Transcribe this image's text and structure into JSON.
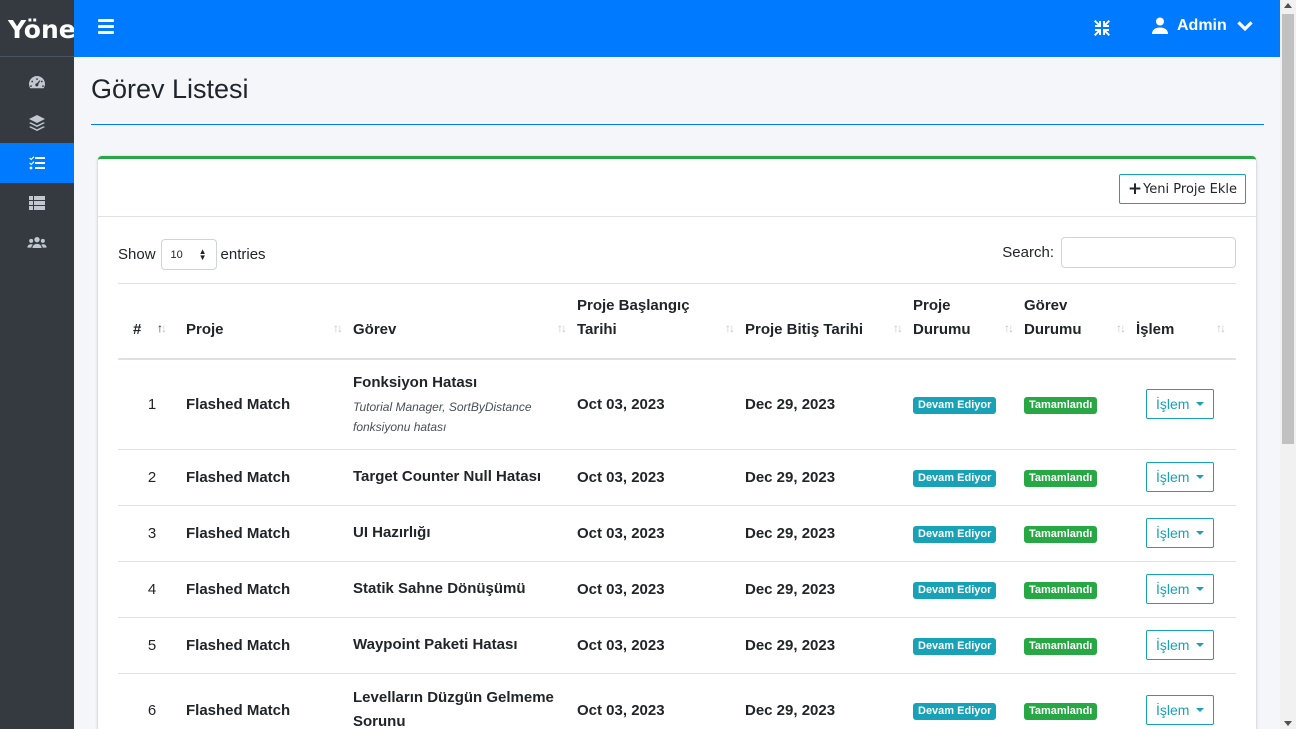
{
  "brand": "Yönetim",
  "nav": [
    {
      "icon": "dashboard-icon",
      "active": false
    },
    {
      "icon": "layers-icon",
      "active": false
    },
    {
      "icon": "task-list-icon",
      "active": true
    },
    {
      "icon": "table-icon",
      "active": false
    },
    {
      "icon": "users-icon",
      "active": false
    }
  ],
  "header": {
    "user": "Admin"
  },
  "page_title": "Görev Listesi",
  "card": {
    "new_button": "Yeni Proje Ekle"
  },
  "table_controls": {
    "show_label": "Show",
    "page_length": "10",
    "entries_label": "entries",
    "search_label": "Search:"
  },
  "columns": [
    "#",
    "Proje",
    "Görev",
    "Proje Başlangıç Tarihi",
    "Proje Bitiş Tarihi",
    "Proje Durumu",
    "Görev Durumu",
    "İşlem"
  ],
  "rows": [
    {
      "no": "1",
      "project": "Flashed Match",
      "task": "Fonksiyon Hatası",
      "desc": "Tutorial Manager, SortByDistance fonksiyonu hatası",
      "start": "Oct 03, 2023",
      "end": "Dec 29, 2023",
      "project_status": "Devam Ediyor",
      "task_status": "Tamamlandı",
      "action": "İşlem"
    },
    {
      "no": "2",
      "project": "Flashed Match",
      "task": "Target Counter Null Hatası",
      "desc": "",
      "start": "Oct 03, 2023",
      "end": "Dec 29, 2023",
      "project_status": "Devam Ediyor",
      "task_status": "Tamamlandı",
      "action": "İşlem"
    },
    {
      "no": "3",
      "project": "Flashed Match",
      "task": "UI Hazırlığı",
      "desc": "",
      "start": "Oct 03, 2023",
      "end": "Dec 29, 2023",
      "project_status": "Devam Ediyor",
      "task_status": "Tamamlandı",
      "action": "İşlem"
    },
    {
      "no": "4",
      "project": "Flashed Match",
      "task": "Statik Sahne Dönüşümü",
      "desc": "",
      "start": "Oct 03, 2023",
      "end": "Dec 29, 2023",
      "project_status": "Devam Ediyor",
      "task_status": "Tamamlandı",
      "action": "İşlem"
    },
    {
      "no": "5",
      "project": "Flashed Match",
      "task": "Waypoint Paketi Hatası",
      "desc": "",
      "start": "Oct 03, 2023",
      "end": "Dec 29, 2023",
      "project_status": "Devam Ediyor",
      "task_status": "Tamamlandı",
      "action": "İşlem"
    },
    {
      "no": "6",
      "project": "Flashed Match",
      "task": "Levelların Düzgün Gelmeme Sorunu",
      "desc": "",
      "start": "Oct 03, 2023",
      "end": "Dec 29, 2023",
      "project_status": "Devam Ediyor",
      "task_status": "Tamamlandı",
      "action": "İşlem"
    }
  ]
}
